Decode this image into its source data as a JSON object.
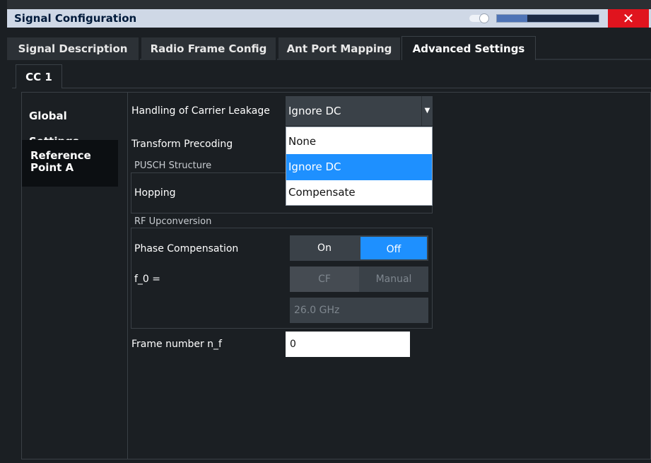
{
  "window": {
    "title": "Signal Configuration",
    "close_glyph": "✕",
    "slider_level": 0.3
  },
  "tabs": [
    "Signal Description",
    "Radio Frame Config",
    "Ant Port Mapping",
    "Advanced Settings"
  ],
  "cc_tab": "CC 1",
  "left_nav": {
    "global": "Global Settings",
    "reference_line1": "Reference",
    "reference_line2": "Point A"
  },
  "settings": {
    "carrier_leakage_label": "Handling of Carrier Leakage",
    "carrier_leakage_value": "Ignore DC",
    "dropdown_options": [
      "None",
      "Ignore DC",
      "Compensate"
    ],
    "transform_precoding_label": "Transform Precoding",
    "pusch_section": "PUSCH Structure",
    "hopping_label": "Hopping",
    "rf_section": "RF Upconversion",
    "phase_comp_label": "Phase Compensation",
    "phase_on": "On",
    "phase_off": "Off",
    "f0_label": "f_0 =",
    "f0_cf": "CF",
    "f0_manual": "Manual",
    "f0_value": "26.0 GHz",
    "frame_number_label": "Frame number n_f",
    "frame_number_value": "0"
  },
  "colors": {
    "accent": "#1e90ff",
    "close_red": "#e0141e",
    "title_bg": "#cfd8e6"
  }
}
